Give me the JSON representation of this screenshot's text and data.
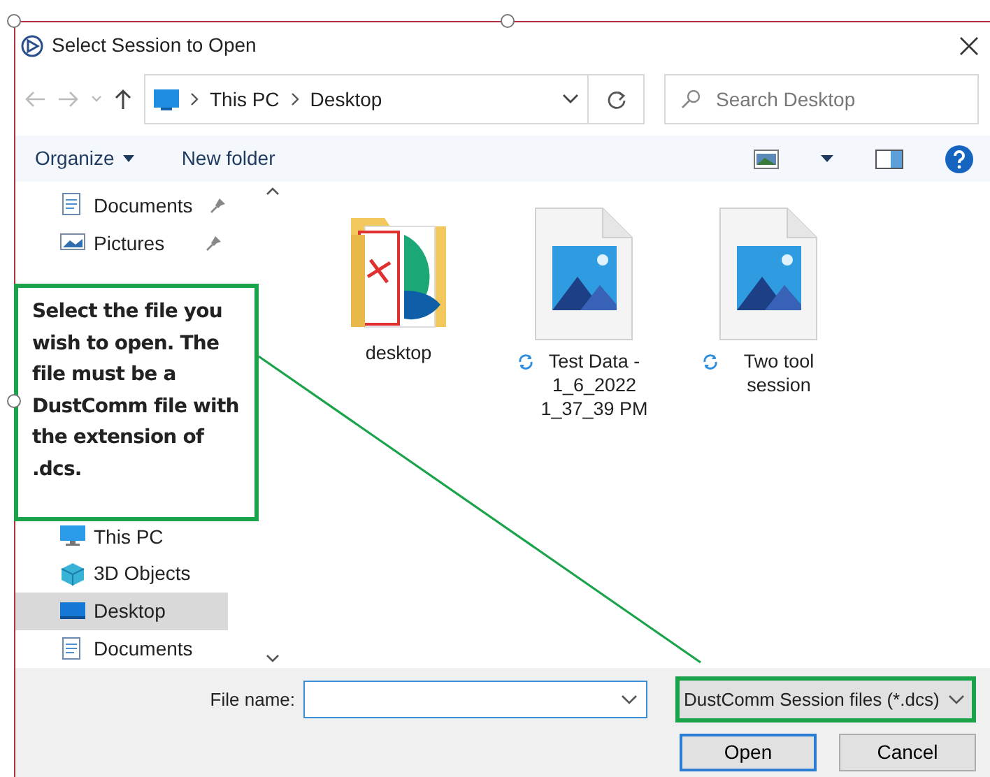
{
  "window": {
    "title": "Select Session to Open"
  },
  "address_bar": {
    "path": [
      "This PC",
      "Desktop"
    ]
  },
  "search": {
    "placeholder": "Search Desktop"
  },
  "toolbar": {
    "buttons": [
      "Organize",
      "New folder"
    ]
  },
  "navigation": {
    "items": [
      {
        "label": "Documents",
        "kind": "documents",
        "pinned": true,
        "selected": false
      },
      {
        "label": "Pictures",
        "kind": "pictures",
        "pinned": true,
        "selected": false
      },
      {
        "label": "This PC",
        "kind": "pc",
        "pinned": false,
        "selected": false
      },
      {
        "label": "3D Objects",
        "kind": "objects",
        "pinned": false,
        "selected": false
      },
      {
        "label": "Desktop",
        "kind": "desktop",
        "pinned": false,
        "selected": true
      },
      {
        "label": "Documents",
        "kind": "documents",
        "pinned": false,
        "selected": false
      }
    ]
  },
  "files": [
    {
      "name": "desktop",
      "kind": "folder",
      "synced": false
    },
    {
      "name": "Test Data - 1_6_2022 1_37_39 PM",
      "kind": "image",
      "synced": true
    },
    {
      "name": "Two tool session",
      "kind": "image",
      "synced": true
    }
  ],
  "file_name": {
    "label": "File name:"
  },
  "file_type": "DustComm Session files (*.dcs)",
  "buttons": [
    "Open",
    "Cancel"
  ],
  "callout": {
    "text": "Select the file you wish to open. The file must be a DustComm  file with the extension of .dcs."
  }
}
